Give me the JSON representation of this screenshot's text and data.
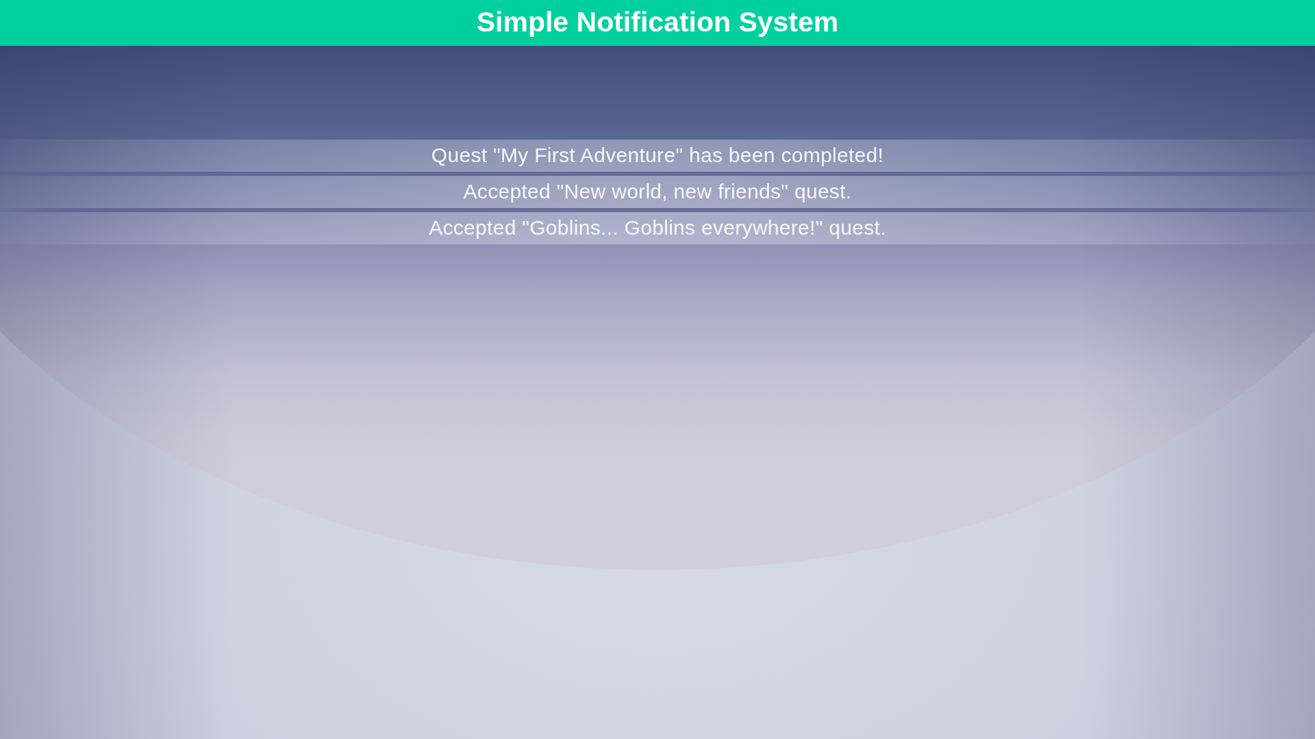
{
  "header": {
    "title": "Simple Notification System"
  },
  "notifications": [
    {
      "text": "Quest \"My First Adventure\" has been completed!"
    },
    {
      "text": "Accepted \"New world, new friends\" quest."
    },
    {
      "text": "Accepted \"Goblins... Goblins everywhere!\" quest."
    }
  ]
}
